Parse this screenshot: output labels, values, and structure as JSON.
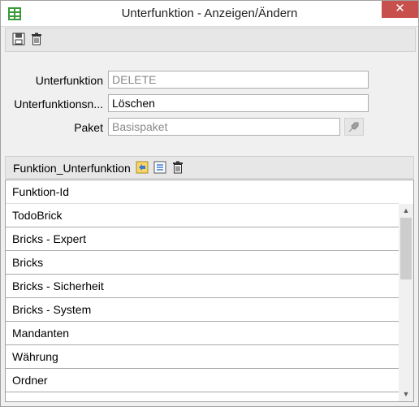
{
  "window": {
    "title": "Unterfunktion - Anzeigen/Ändern",
    "close_glyph": "✕"
  },
  "toolbar": {
    "buttons": [
      {
        "icon": "save-icon"
      },
      {
        "icon": "trash-icon"
      }
    ]
  },
  "form": {
    "fields": [
      {
        "label": "Unterfunktion",
        "value": "DELETE",
        "readonly": true
      },
      {
        "label": "Unterfunktionsn...",
        "value": "Löschen",
        "readonly": false
      },
      {
        "label": "Paket",
        "value": "Basispaket",
        "readonly": true
      }
    ]
  },
  "subform": {
    "title": "Funktion_Unterfunktion",
    "column_header": "Funktion-Id",
    "rows": [
      "TodoBrick",
      "Bricks - Expert",
      "Bricks",
      "Bricks - Sicherheit",
      "Bricks - System",
      "Mandanten",
      "Währung",
      "Ordner"
    ]
  },
  "scrollbar": {
    "up_glyph": "▲",
    "down_glyph": "▼"
  },
  "colors": {
    "close": "#c7504c",
    "toolbar": "#e7e7e7"
  }
}
